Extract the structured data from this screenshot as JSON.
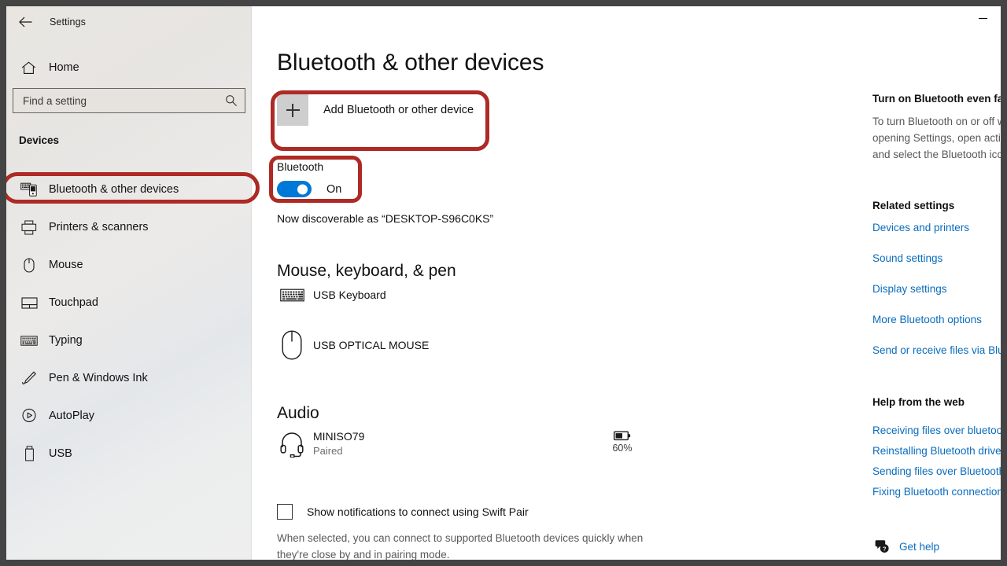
{
  "window": {
    "title": "Settings",
    "minimize_label": "Minimize",
    "back_label": "Back"
  },
  "sidebar": {
    "home_label": "Home",
    "search": {
      "placeholder": "Find a setting",
      "value": ""
    },
    "group_label": "Devices",
    "items": [
      {
        "label": "Bluetooth & other devices",
        "icon": "bluetooth-devices-icon",
        "selected": true
      },
      {
        "label": "Printers & scanners",
        "icon": "printer-icon",
        "selected": false
      },
      {
        "label": "Mouse",
        "icon": "mouse-icon",
        "selected": false
      },
      {
        "label": "Touchpad",
        "icon": "touchpad-icon",
        "selected": false
      },
      {
        "label": "Typing",
        "icon": "keyboard-icon",
        "selected": false
      },
      {
        "label": "Pen & Windows Ink",
        "icon": "pen-icon",
        "selected": false
      },
      {
        "label": "AutoPlay",
        "icon": "autoplay-icon",
        "selected": false
      },
      {
        "label": "USB",
        "icon": "usb-icon",
        "selected": false
      }
    ]
  },
  "main": {
    "page_title": "Bluetooth & other devices",
    "add_device_label": "Add Bluetooth or other device",
    "bluetooth": {
      "label": "Bluetooth",
      "state": "On",
      "enabled": true,
      "discoverable_text": "Now discoverable as “DESKTOP-S96C0KS”"
    },
    "sections": [
      {
        "heading": "Mouse, keyboard, & pen",
        "devices": [
          {
            "name": "USB Keyboard",
            "status": "",
            "icon": "keyboard-icon"
          },
          {
            "name": "USB OPTICAL MOUSE",
            "status": "",
            "icon": "mouse-icon"
          }
        ]
      },
      {
        "heading": "Audio",
        "devices": [
          {
            "name": "MINISO79",
            "status": "Paired",
            "icon": "headset-icon",
            "battery": "60%"
          }
        ]
      }
    ],
    "swift_pair": {
      "label": "Show notifications to connect using Swift Pair",
      "checked": false,
      "description": "When selected, you can connect to supported Bluetooth devices quickly when they're close by and in pairing mode."
    }
  },
  "right_pane": {
    "tip_heading": "Turn on Bluetooth even faster",
    "tip_lines": [
      "To turn Bluetooth on or off without",
      "opening Settings, open action center",
      "and select the Bluetooth icon."
    ],
    "related_heading": "Related settings",
    "related_links": [
      "Devices and printers",
      "Sound settings",
      "Display settings",
      "More Bluetooth options",
      "Send or receive files via Bluetooth"
    ],
    "help_heading": "Help from the web",
    "help_links": [
      "Receiving files over bluetooth",
      "Reinstalling Bluetooth driver",
      "Sending files over Bluetooth",
      "Fixing Bluetooth connections"
    ],
    "get_help_label": "Get help"
  },
  "annotations": {
    "color": "#ad2a25",
    "targets": [
      "sidebar-item-bluetooth-other-devices",
      "add-bluetooth-or-other-device-button",
      "bluetooth-toggle"
    ]
  }
}
